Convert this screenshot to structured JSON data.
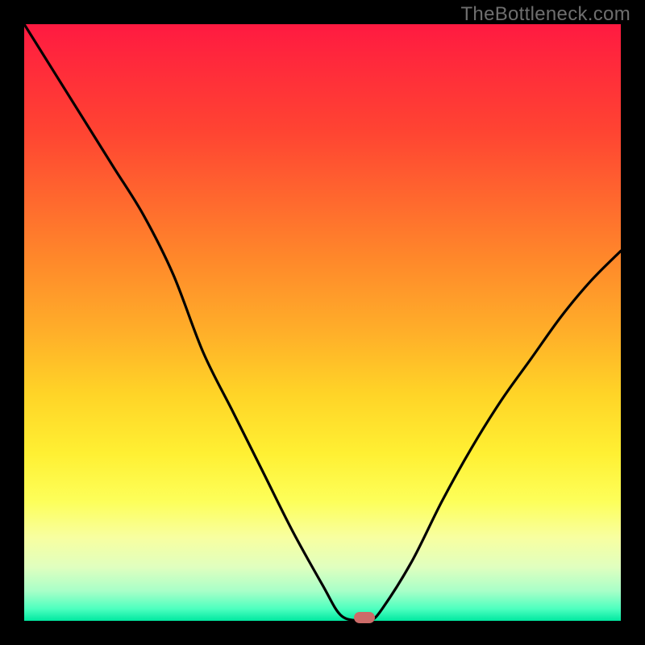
{
  "watermark": "TheBottleneck.com",
  "colors": {
    "frame_bg": "#000000",
    "gradient_top": "#ff1a41",
    "gradient_bottom": "#00e8a0",
    "curve": "#000000",
    "marker": "#cc6b68"
  },
  "chart_data": {
    "type": "line",
    "title": "",
    "xlabel": "",
    "ylabel": "",
    "xlim": [
      0,
      100
    ],
    "ylim": [
      0,
      100
    ],
    "series": [
      {
        "name": "bottleneck-curve",
        "x": [
          0,
          5,
          10,
          15,
          20,
          25,
          30,
          35,
          40,
          45,
          50,
          53,
          56,
          58,
          60,
          65,
          70,
          75,
          80,
          85,
          90,
          95,
          100
        ],
        "y": [
          100,
          92,
          84,
          76,
          68,
          58,
          45,
          35,
          25,
          15,
          6,
          1,
          0,
          0,
          2,
          10,
          20,
          29,
          37,
          44,
          51,
          57,
          62
        ]
      }
    ],
    "marker": {
      "x": 57,
      "y": 0.5
    },
    "annotations": []
  }
}
